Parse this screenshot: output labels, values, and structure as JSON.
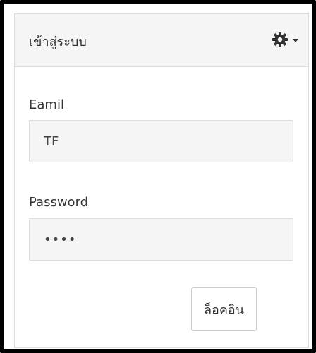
{
  "panel": {
    "title": "เข้าสู่ระบบ",
    "settings_icon": "gear-icon",
    "dropdown_icon": "caret-down-icon"
  },
  "form": {
    "email_label": "Eamil",
    "email_value": "TF",
    "password_label": "Password",
    "password_value": "1234",
    "login_label": "ล็อคอิน"
  },
  "colors": {
    "frame_border": "#000000",
    "heading_bg": "#f5f5f5",
    "input_bg": "#f5f5f5",
    "text": "#333333"
  }
}
